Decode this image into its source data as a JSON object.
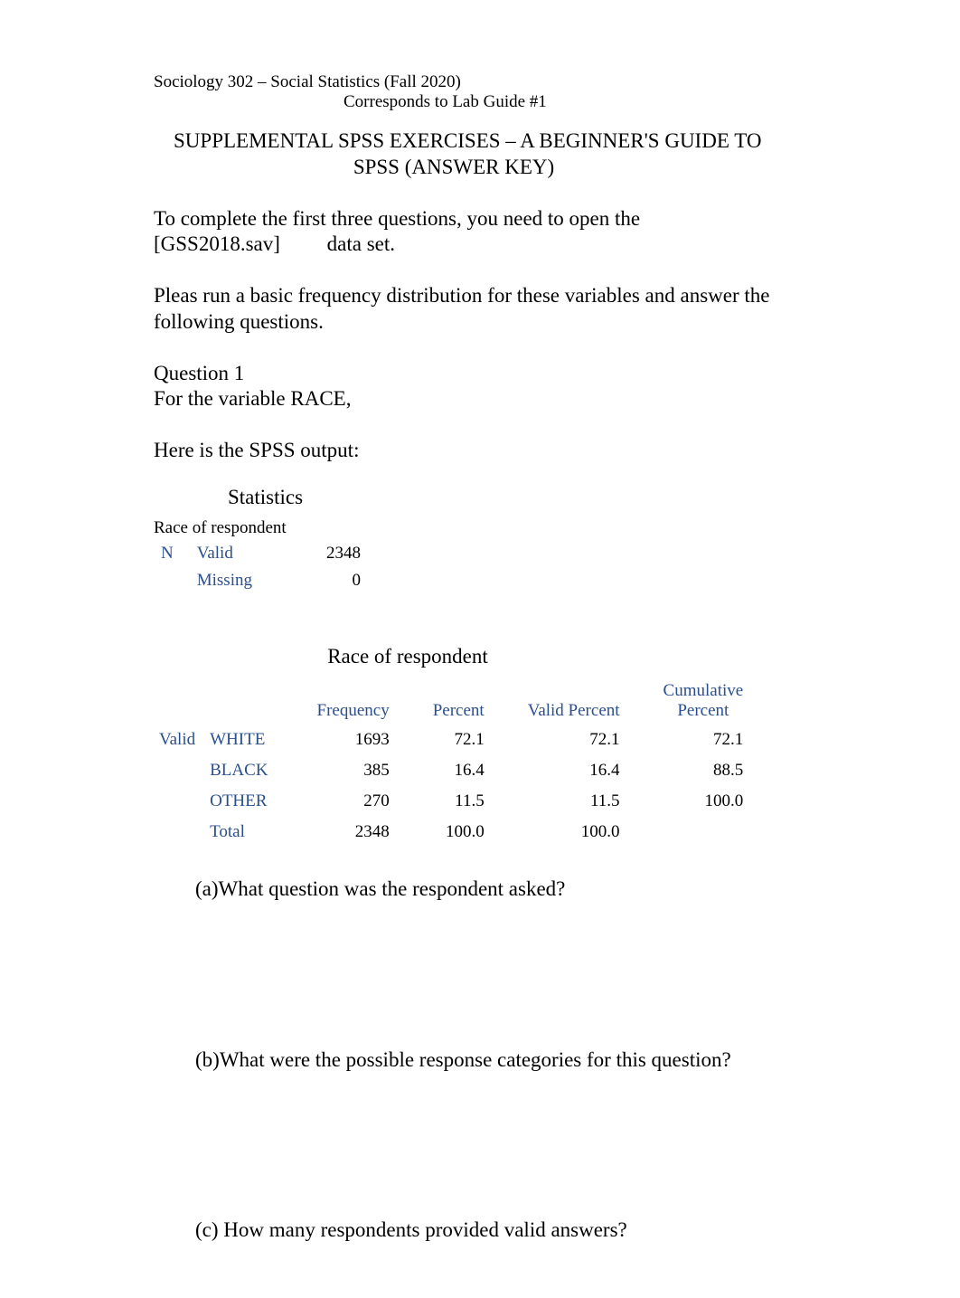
{
  "header": {
    "course": "Sociology 302 – Social Statistics (Fall 2020)",
    "corresponds": "Corresponds to Lab Guide #1"
  },
  "title": {
    "line1": "SUPPLEMENTAL SPSS EXERCISES – A BEGINNER'S GUIDE TO",
    "line2": "SPSS (ANSWER KEY)"
  },
  "intro": {
    "p1a": "To complete the first three questions, you need to open the",
    "dataset": "[GSS2018.sav]",
    "p1b": "data set.",
    "p2": "Pleas run a basic frequency distribution for these variables and answer the following questions.",
    "q1_label": "Question 1",
    "q1_text": "For the variable RACE,",
    "output_label": "Here is the SPSS output:"
  },
  "statistics": {
    "title": "Statistics",
    "caption": "Race of respondent",
    "n_label": "N",
    "rows": [
      {
        "label": "Valid",
        "value": "2348"
      },
      {
        "label": "Missing",
        "value": "0"
      }
    ]
  },
  "frequency": {
    "title": "Race of respondent",
    "headers": {
      "frequency": "Frequency",
      "percent": "Percent",
      "valid_percent": "Valid Percent",
      "cumulative_top": "Cumulative",
      "cumulative_bottom": "Percent"
    },
    "side_label": "Valid",
    "rows": [
      {
        "label": "WHITE",
        "frequency": "1693",
        "percent": "72.1",
        "valid_percent": "72.1",
        "cumulative": "72.1"
      },
      {
        "label": "BLACK",
        "frequency": "385",
        "percent": "16.4",
        "valid_percent": "16.4",
        "cumulative": "88.5"
      },
      {
        "label": "OTHER",
        "frequency": "270",
        "percent": "11.5",
        "valid_percent": "11.5",
        "cumulative": "100.0"
      },
      {
        "label": "Total",
        "frequency": "2348",
        "percent": "100.0",
        "valid_percent": "100.0",
        "cumulative": ""
      }
    ]
  },
  "questions": {
    "a": "(a)What question was the respondent asked?",
    "b": "(b)What were the possible response categories for this question?",
    "c": "(c) How many respondents provided valid answers?"
  }
}
